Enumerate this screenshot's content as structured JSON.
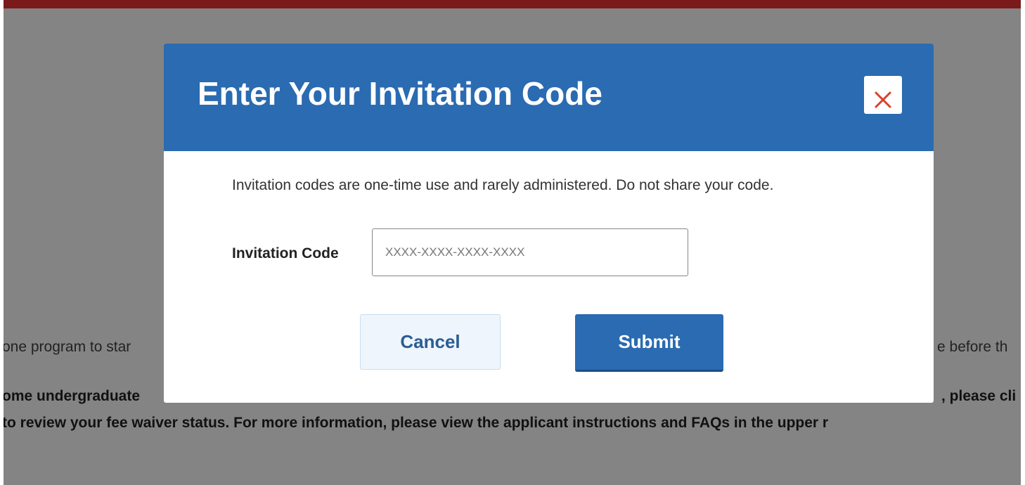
{
  "background": {
    "line1_left": "one program to star",
    "line1_right": "e before th",
    "line2_left": "ome undergraduate",
    "line2_right": ", please cli",
    "line3": "to review your fee waiver status. For more information, please view the applicant instructions and FAQs in the upper r"
  },
  "modal": {
    "title": "Enter Your Invitation Code",
    "description": "Invitation codes are one-time use and rarely administered. Do not share your code.",
    "field_label": "Invitation Code",
    "input_placeholder": "XXXX-XXXX-XXXX-XXXX",
    "input_value": "",
    "cancel_label": "Cancel",
    "submit_label": "Submit",
    "close_icon": "close-icon"
  },
  "colors": {
    "header": "#2a6bb1",
    "overlay": "#848484",
    "top_bar": "#7a1a1a",
    "close_icon": "#d9402b"
  }
}
